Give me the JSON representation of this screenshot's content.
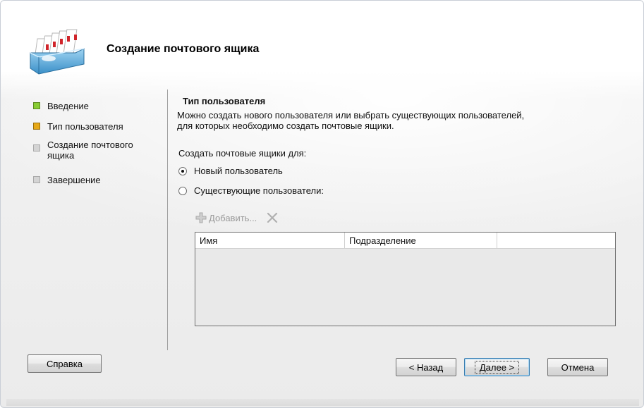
{
  "window": {
    "title": "Создание почтового ящика"
  },
  "steps": [
    {
      "label": "Введение",
      "state": "done"
    },
    {
      "label": "Тип пользователя",
      "state": "current"
    },
    {
      "label": "Создание почтового ящика",
      "state": "pending"
    },
    {
      "label": "Завершение",
      "state": "pending"
    }
  ],
  "section": {
    "title": "Тип пользователя",
    "description_line1": "Можно создать нового пользователя или выбрать существующих пользователей,",
    "description_line2": "для которых необходимо создать почтовые ящики.",
    "create_for_label": "Создать почтовые ящики для:",
    "options": [
      {
        "label": "Новый пользователь",
        "selected": true
      },
      {
        "label": "Существующие пользователи:",
        "selected": false
      }
    ]
  },
  "toolbar": {
    "add_label": "Добавить...",
    "add_icon": "plus-icon",
    "remove_icon": "remove-x-icon"
  },
  "grid": {
    "columns": [
      "Имя",
      "Подразделение",
      ""
    ]
  },
  "buttons": {
    "help": "Справка",
    "back": "< Назад",
    "next": "Далее >",
    "cancel": "Отмена"
  },
  "colors": {
    "step_done": "#88cc33",
    "step_current": "#e6a817",
    "step_pending": "#d4d4d4",
    "default_button_border": "#3c7fb1"
  }
}
